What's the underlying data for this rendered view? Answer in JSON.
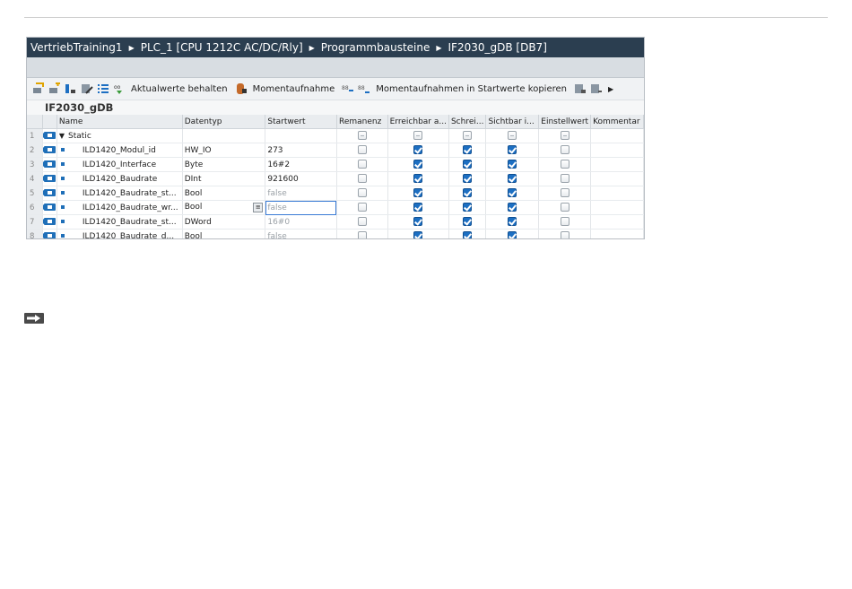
{
  "title": {
    "parts": [
      "VertriebTraining1",
      "PLC_1 [CPU 1212C AC/DC/Rly]",
      "Programmbausteine",
      "IF2030_gDB [DB7]"
    ]
  },
  "toolbar": {
    "keep_actual_label": "Aktualwerte behalten",
    "snapshot_label": "Momentaufnahme",
    "copy_snapshots_label": "Momentaufnahmen in Startwerte kopieren"
  },
  "block_name": "IF2030_gDB",
  "table": {
    "headers": [
      "Name",
      "Datentyp",
      "Startwert",
      "Remanenz",
      "Erreichbar a...",
      "Schrei...",
      "Sichtbar i...",
      "Einstellwert",
      "Kommentar"
    ],
    "rows": [
      {
        "num": "1",
        "name": "Static",
        "type": "",
        "start": "",
        "start_dim": false,
        "rem": "grey",
        "err": "grey",
        "schr": "grey",
        "sicht": "grey",
        "einst": "grey",
        "comment": "",
        "group": true
      },
      {
        "num": "2",
        "name": "ILD1420_Modul_id",
        "type": "HW_IO",
        "start": "273",
        "start_dim": false,
        "rem": "off",
        "err": "on",
        "schr": "on",
        "sicht": "on",
        "einst": "off",
        "comment": ""
      },
      {
        "num": "3",
        "name": "ILD1420_Interface",
        "type": "Byte",
        "start": "16#2",
        "start_dim": false,
        "rem": "off",
        "err": "on",
        "schr": "on",
        "sicht": "on",
        "einst": "off",
        "comment": ""
      },
      {
        "num": "4",
        "name": "ILD1420_Baudrate",
        "type": "DInt",
        "start": "921600",
        "start_dim": false,
        "rem": "off",
        "err": "on",
        "schr": "on",
        "sicht": "on",
        "einst": "off",
        "comment": ""
      },
      {
        "num": "5",
        "name": "ILD1420_Baudrate_st...",
        "type": "Bool",
        "start": "false",
        "start_dim": true,
        "rem": "off",
        "err": "on",
        "schr": "on",
        "sicht": "on",
        "einst": "off",
        "comment": ""
      },
      {
        "num": "6",
        "name": "ILD1420_Baudrate_wr...",
        "type": "Bool",
        "start": "false",
        "start_dim": true,
        "rem": "off",
        "err": "on",
        "schr": "on",
        "sicht": "on",
        "einst": "off",
        "comment": "",
        "editing": true
      },
      {
        "num": "7",
        "name": "ILD1420_Baudrate_st...",
        "type": "DWord",
        "start": "16#0",
        "start_dim": true,
        "rem": "off",
        "err": "on",
        "schr": "on",
        "sicht": "on",
        "einst": "off",
        "comment": ""
      },
      {
        "num": "8",
        "name": "ILD1420_Baudrate_d...",
        "type": "Bool",
        "start": "false",
        "start_dim": true,
        "rem": "off",
        "err": "on",
        "schr": "on",
        "sicht": "on",
        "einst": "off",
        "comment": ""
      }
    ]
  },
  "icons": [
    "arrow-right-icon"
  ],
  "colors": {
    "titlebar": "#2b3e50",
    "checked": "#1d6fc2"
  }
}
